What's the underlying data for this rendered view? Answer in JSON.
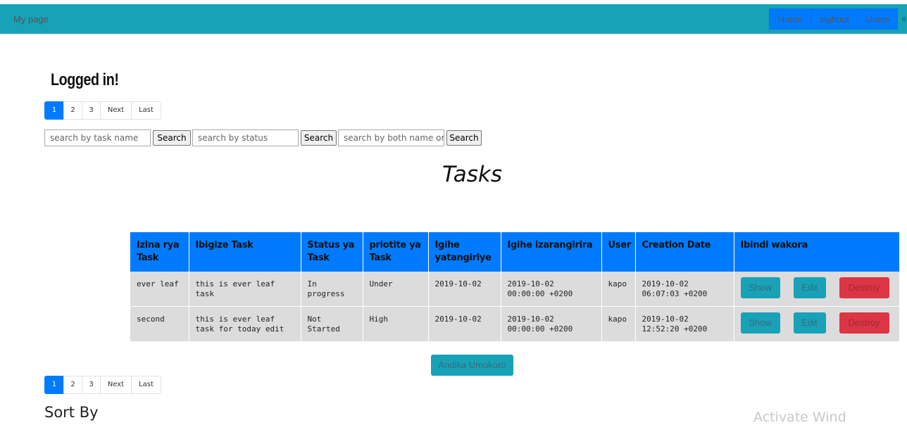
{
  "navbar": {
    "brand": "My page",
    "buttons": [
      "Home",
      "sighout",
      "Users"
    ],
    "overflow_char": "o"
  },
  "heading": "Logged in!",
  "pagination": {
    "pages": [
      "1",
      "2",
      "3"
    ],
    "next": "Next",
    "last": "Last",
    "active_page": "1"
  },
  "search": {
    "name_placeholder": "search by task name",
    "status_placeholder": "search by status",
    "both_placeholder": "search by both name or s",
    "button_label": "Search"
  },
  "tasks_title": "Tasks",
  "table": {
    "headers": [
      "Izina rya Task",
      "Ibigize Task",
      "Status ya Task",
      "priotite ya Task",
      "Igihe yatangiriye",
      "Igihe izarangirira",
      "User",
      "Creation Date",
      "Ibindi wakora"
    ],
    "rows": [
      {
        "name": "ever leaf",
        "content": "this is ever leaf task",
        "status": "In progress",
        "priority": "Under",
        "start": "2019-10-02",
        "end": "2019-10-02 00:00:00 +0200",
        "user": "kapo",
        "created": "2019-10-02 06:07:03 +0200"
      },
      {
        "name": "second",
        "content": "this is ever leaf task for today edit",
        "status": "Not Started",
        "priority": "High",
        "start": "2019-10-02",
        "end": "2019-10-02 00:00:00 +0200",
        "user": "kapo",
        "created": "2019-10-02 12:52:20 +0200"
      }
    ],
    "actions": {
      "show": "Show",
      "edit": "Edit",
      "destroy": "Destroy"
    }
  },
  "add_button": "Andika Umukoro",
  "sort_by": "Sort By",
  "watermark": "Activate Wind",
  "colors": {
    "navbar": "#17a2b8",
    "primary": "#007bff",
    "danger": "#dc3545",
    "row_bg": "#dcdcdc"
  }
}
